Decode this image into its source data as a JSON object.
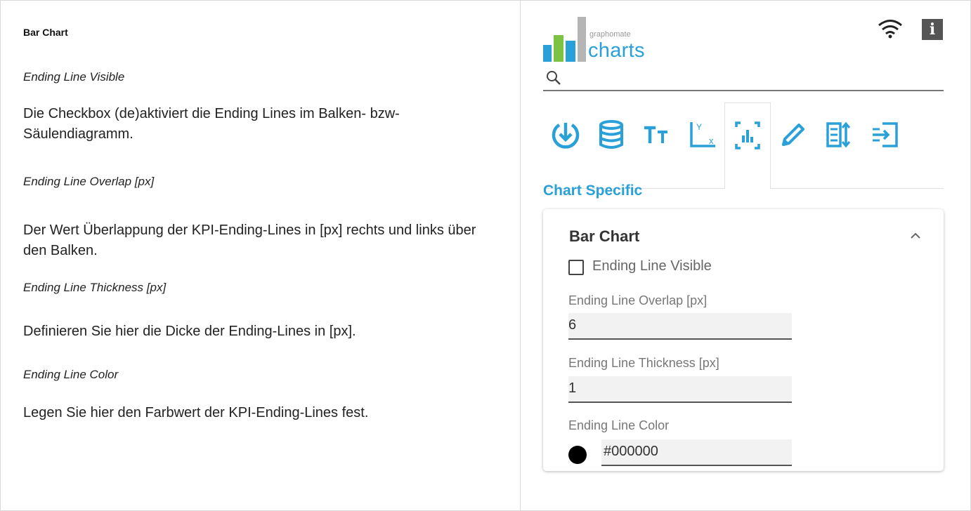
{
  "doc": {
    "title": "Bar Chart",
    "items": [
      {
        "heading": "Ending Line Visible",
        "text": "Die Checkbox (de)aktiviert die Ending Lines im Balken- bzw- Säulendiagramm."
      },
      {
        "heading": "Ending Line Overlap [px]",
        "text": "Der Wert Überlappung der KPI-Ending-Lines in [px] rechts und links über den Balken."
      },
      {
        "heading": "Ending Line Thickness [px]",
        "text": "Definieren Sie hier die Dicke der Ending-Lines in [px]."
      },
      {
        "heading": "Ending Line Color",
        "text": "Legen Sie hier den Farbwert der KPI-Ending-Lines fest."
      }
    ]
  },
  "panel": {
    "logo_small": "graphomate",
    "logo_text": "charts",
    "search_placeholder": "",
    "tabs": [
      {
        "icon": "download-icon"
      },
      {
        "icon": "database-icon"
      },
      {
        "icon": "text-size-icon"
      },
      {
        "icon": "axis-icon"
      },
      {
        "icon": "chart-specific-icon"
      },
      {
        "icon": "pencil-icon"
      },
      {
        "icon": "sort-icon"
      },
      {
        "icon": "import-icon"
      }
    ],
    "active_tab": 4,
    "section_title": "Chart Specific",
    "card": {
      "title": "Bar Chart",
      "checkbox_label": "Ending Line Visible",
      "checkbox_checked": false,
      "overlap_label": "Ending Line Overlap [px]",
      "overlap_value": "6",
      "thickness_label": "Ending Line Thickness [px]",
      "thickness_value": "1",
      "color_label": "Ending Line Color",
      "color_value": "#000000"
    },
    "accent_color": "#2aa0d8"
  }
}
